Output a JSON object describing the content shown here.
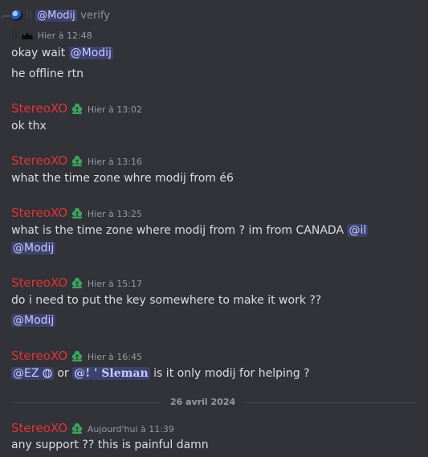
{
  "reply": {
    "author": "il",
    "mention": "@Modij",
    "text": "verify"
  },
  "messages": [
    {
      "author": "il",
      "time": "Hier à 12:48",
      "lines": [
        {
          "text": "okay wait ",
          "mention": "@Modij"
        },
        {
          "text": "he offline rtn"
        }
      ]
    },
    {
      "author": "StereoXO",
      "time": "Hier à 13:02",
      "lines": [
        {
          "text": "ok thx"
        }
      ]
    },
    {
      "author": "StereoXO",
      "time": "Hier à 13:16",
      "lines": [
        {
          "text": "what the time zone whre modij from é6"
        }
      ]
    },
    {
      "author": "StereoXO",
      "time": "Hier à 13:25",
      "lines": [
        {
          "text": "what is the time zone where modij from ? im from CANADA ",
          "mention": "@il"
        },
        {
          "mention": "@Modij"
        }
      ]
    },
    {
      "author": "StereoXO",
      "time": "Hier à 15:17",
      "lines": [
        {
          "text": "do i need to put the key somewhere to make it work ??"
        },
        {
          "mention": "@Modij"
        }
      ]
    },
    {
      "author": "StereoXO",
      "time": "Hier à 16:45",
      "lines": [
        {
          "mention1": "@EZ",
          "mid": " or ",
          "mention2": "@! ' Sleman",
          "text": " is it only modij for helping ?"
        }
      ]
    }
  ],
  "divider": "26 avril 2024",
  "last_message": {
    "author": "StereoXO",
    "time": "Aujourd'hui à 11:39",
    "text": "any support ?? this is painful damn"
  },
  "colors": {
    "background": "#313338",
    "username": "#e03434",
    "mention_bg": "#3c4270",
    "badge": "#3ba55d"
  },
  "icons": {
    "reply_avatar": "avatar-icon",
    "crown": "crown-icon",
    "badge": "clover-badge-icon",
    "ez_status": "globe-icon"
  }
}
